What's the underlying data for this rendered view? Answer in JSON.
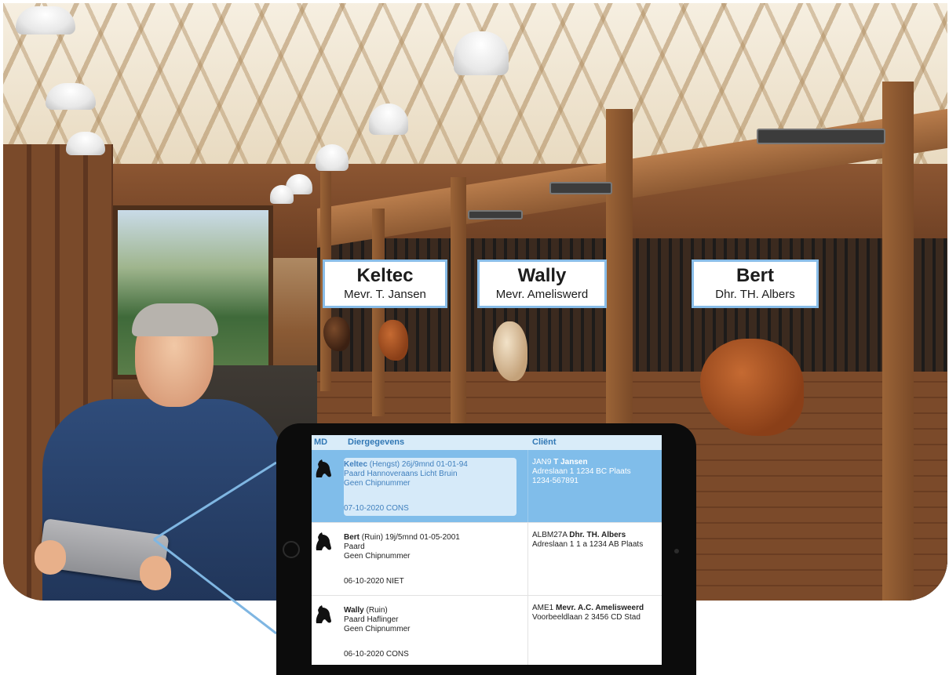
{
  "name_cards": [
    {
      "horse": "Keltec",
      "owner": "Mevr. T. Jansen"
    },
    {
      "horse": "Wally",
      "owner": "Mevr. Ameliswerd"
    },
    {
      "horse": "Bert",
      "owner": "Dhr. TH. Albers"
    }
  ],
  "table": {
    "headers": {
      "md": "MD",
      "animal": "Diergegevens",
      "client": "Cliënt"
    },
    "rows": [
      {
        "icon": "horse-head-icon",
        "name": "Keltec",
        "details": "(Hengst) 26j/9mnd 01-01-94",
        "line2": "Paard Hannoveraans Licht Bruin",
        "line3": "Geen Chipnummer",
        "date": "07-10-2020 CONS",
        "client_code": "JAN9",
        "client_name": "T Jansen",
        "client_address": "Adreslaan 1 1234 BC Plaats",
        "client_phone": "1234-567891",
        "selected": true
      },
      {
        "icon": "horse-head-icon",
        "name": "Bert",
        "details": "(Ruin) 19j/5mnd 01-05-2001",
        "line2": "Paard",
        "line3": "Geen Chipnummer",
        "date": "06-10-2020 NIET",
        "client_code": "ALBM27A",
        "client_name": "Dhr. TH. Albers",
        "client_address": "Adreslaan 1 1 a 1234 AB Plaats",
        "client_phone": "",
        "selected": false
      },
      {
        "icon": "horse-head-icon",
        "name": "Wally",
        "details": "(Ruin)",
        "line2": "Paard Haflinger",
        "line3": "Geen Chipnummer",
        "date": "06-10-2020 CONS",
        "client_code": "AME1",
        "client_name": "Mevr. A.C. Amelisweerd",
        "client_address": "Voorbeeldlaan 2 3456 CD Stad",
        "client_phone": "",
        "selected": false
      }
    ]
  },
  "colors": {
    "card_border": "#89bde8",
    "selected_row": "#80bdea",
    "header_bg": "#d9ecf9",
    "header_text": "#3178b5"
  }
}
